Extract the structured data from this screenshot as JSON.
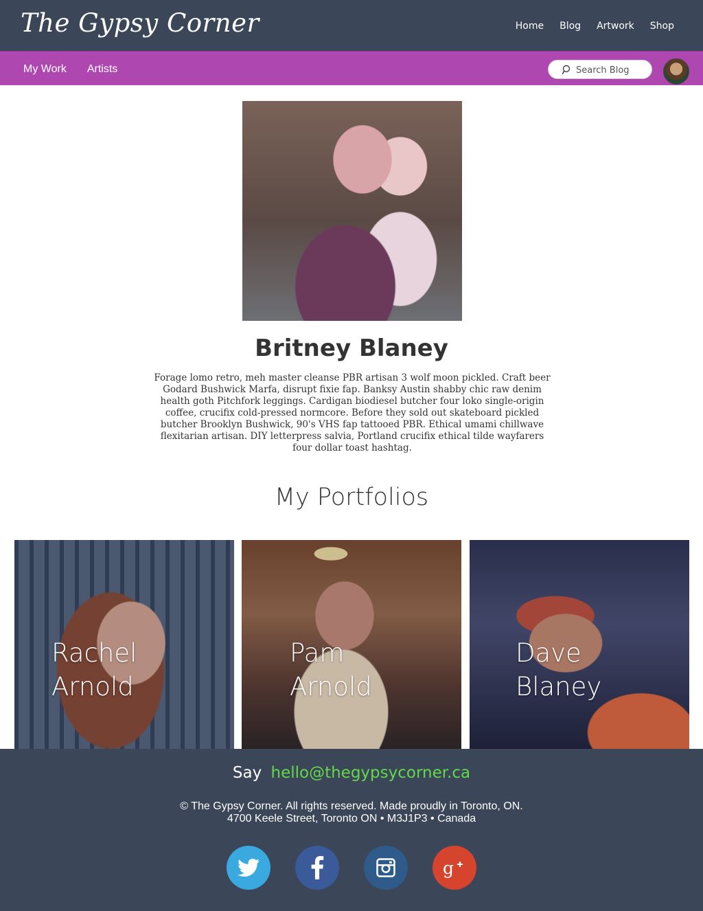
{
  "header": {
    "logo": "The Gypsy Corner",
    "nav": [
      "Home",
      "Blog",
      "Artwork",
      "Shop"
    ]
  },
  "subnav": {
    "items": [
      "My Work",
      "Artists"
    ],
    "search_placeholder": "Search Blog",
    "search_icon": "search-icon",
    "avatar": "user-avatar"
  },
  "profile": {
    "name": "Britney Blaney",
    "bio": "Forage lomo retro, meh master cleanse PBR artisan 3 wolf moon pickled. Craft beer Godard Bushwick Marfa, disrupt fixie fap. Banksy Austin shabby chic raw denim health goth Pitchfork leggings. Cardigan biodiesel butcher four loko single-origin coffee, crucifix cold-pressed normcore. Before they sold out skateboard pickled butcher Brooklyn Bushwick, 90's VHS fap tattooed PBR. Ethical umami chillwave flexitarian artisan. DIY letterpress salvia, Portland crucifix ethical tilde wayfarers four dollar toast hashtag."
  },
  "portfolios": {
    "title": "My Portfolios",
    "items": [
      {
        "first": "Rachel",
        "last": "Arnold"
      },
      {
        "first": "Pam",
        "last": "Arnold"
      },
      {
        "first": "Dave",
        "last": "Blaney"
      }
    ]
  },
  "footer": {
    "say": "Say",
    "email": "hello@thegypsycorner.ca",
    "copyright": "© The Gypsy Corner. All rights reserved. Made proudly in Toronto, ON.",
    "address": "4700 Keele Street, Toronto ON • M3J1P3 • Canada",
    "socials": [
      "twitter-icon",
      "facebook-icon",
      "instagram-icon",
      "google-plus-icon"
    ]
  },
  "colors": {
    "header_bg": "#3b4758",
    "subnav_bg": "#ae47b0",
    "email_link": "#62d84a",
    "twitter": "#39a9e0",
    "facebook": "#3a5a99",
    "instagram": "#2e5b8a",
    "google_plus": "#d6442e"
  }
}
